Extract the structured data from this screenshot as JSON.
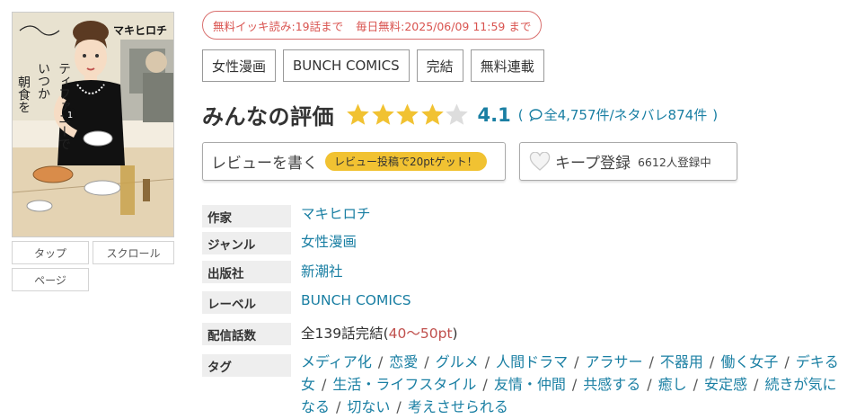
{
  "cover": {
    "author_on_cover": "マキヒロチ",
    "title_on_cover": "いつかティファニーで朝食を",
    "volume": "1"
  },
  "view_buttons": [
    "タップ",
    "スクロール",
    "ページ"
  ],
  "free_badge": {
    "left": "無料イッキ読み:19話まで",
    "right": "毎日無料:2025/06/09 11:59 まで"
  },
  "genre_tags": [
    "女性漫画",
    "BUNCH COMICS",
    "完結",
    "無料連載"
  ],
  "rating": {
    "title": "みんなの評価",
    "stars_filled": 4,
    "stars_total": 5,
    "score": "4.1",
    "open_paren": "(",
    "counts": "全4,757件/ネタバレ874件",
    "close_paren": ")"
  },
  "review_button": {
    "label": "レビューを書く",
    "promo": "レビュー投稿で20ptゲット！"
  },
  "keep_button": {
    "label": "キープ登録",
    "count": "6612人登録中"
  },
  "info": {
    "author_label": "作家",
    "author": "マキヒロチ",
    "genre_label": "ジャンル",
    "genre": "女性漫画",
    "publisher_label": "出版社",
    "publisher": "新潮社",
    "label_label": "レーベル",
    "label": "BUNCH COMICS",
    "episodes_label": "配信話数",
    "episodes": "全139話完結",
    "episodes_pt_open": "(",
    "episodes_pt": "40〜50pt",
    "episodes_pt_close": ")",
    "tags_label": "タグ"
  },
  "tags": [
    "メディア化",
    "恋愛",
    "グルメ",
    "人間ドラマ",
    "アラサー",
    "不器用",
    "働く女子",
    "デキる女",
    "生活・ライフスタイル",
    "友情・仲間",
    "共感する",
    "癒し",
    "安定感",
    "続きが気になる",
    "切ない",
    "考えさせられる"
  ],
  "tag_separator": "/",
  "colors": {
    "accent": "#1a7fa3",
    "badge": "#d9534f",
    "star_on": "#f1c232",
    "star_off": "#dddddd",
    "pill": "#f1c232"
  }
}
